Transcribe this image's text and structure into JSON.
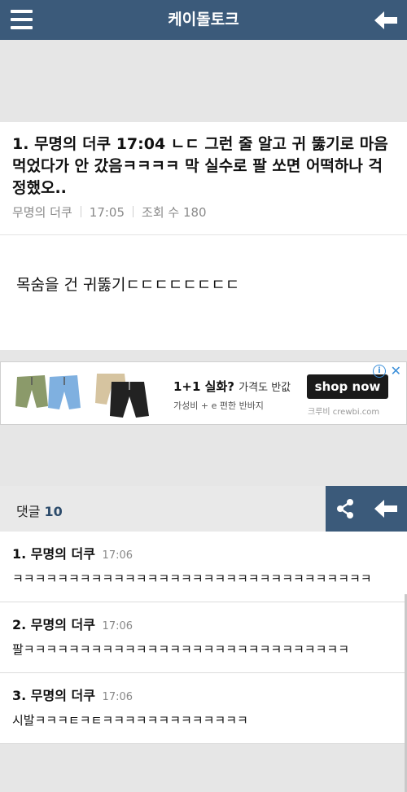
{
  "header": {
    "title": "케이돌토크",
    "menu_icon": "hamburger-icon",
    "back_icon": "arrow-left-icon"
  },
  "post": {
    "number": "1.",
    "title": "무명의 더쿠 17:04 ㄴㄷ 그런 줄 알고 귀 뚫기로 마음 먹었다가 안 갔음ㅋㅋㅋㅋ 막 실수로 팔 쏘면 어떡하나 걱정했오..",
    "author": "무명의 더쿠",
    "time": "17:05",
    "views": "조회 수 180",
    "content": "목숨을 건 귀뚫기ㄷㄷㄷㄷㄷㄷㄷㄷ"
  },
  "ad": {
    "headline": "1+1 실화?",
    "headline_light": "가격도 반값",
    "sub": "가성비 + e 편한 반바지",
    "button": "shop now",
    "brand": "크루비 crewbi.com",
    "info_icon": "ⓘ",
    "close_icon": "✕"
  },
  "comments_bar": {
    "label": "댓글",
    "count": "10",
    "share_icon": "share-icon",
    "back_icon": "arrow-left-icon"
  },
  "comments": [
    {
      "num": "1.",
      "author": "무명의 더쿠",
      "time": "17:06",
      "text": "ㅋㅋㅋㅋㅋㅋㅋㅋㅋㅋㅋㅋㅋㅋㅋㅋㅋㅋㅋㅋㅋㅋㅋㅋㅋㅋㅋㅋㅋㅋㅋㅋ"
    },
    {
      "num": "2.",
      "author": "무명의 더쿠",
      "time": "17:06",
      "text": "팔ㅋㅋㅋㅋㅋㅋㅋㅋㅋㅋㅋㅋㅋㅋㅋㅋㅋㅋㅋㅋㅋㅋㅋㅋㅋㅋㅋㅋㅋ"
    },
    {
      "num": "3.",
      "author": "무명의 더쿠",
      "time": "17:06",
      "text": "시발ㅋㅋㅋㅌㅋㅌㅋㅋㅋㅋㅋㅋㅋㅋㅋㅋㅋㅋㅋ"
    }
  ],
  "colors": {
    "header_bg": "#3b5a7a",
    "accent": "#2c4b6b"
  }
}
